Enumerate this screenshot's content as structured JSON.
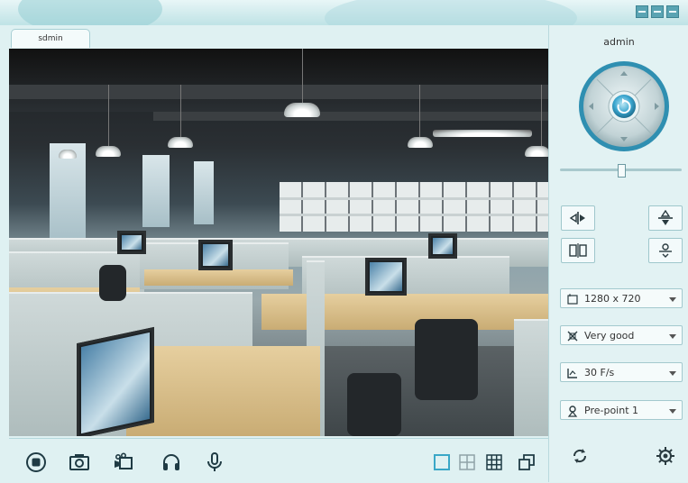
{
  "window": {
    "title_controls": [
      "minimize-icon",
      "maximize-icon",
      "close-icon"
    ]
  },
  "tabs": [
    {
      "label": "sdmin",
      "active": true
    }
  ],
  "toolbar": {
    "icons": [
      "stop-icon",
      "camera-icon",
      "video-record-icon",
      "headphones-icon",
      "microphone-icon"
    ],
    "layout_icons": [
      "single-view-icon",
      "quad-view-icon",
      "nine-view-icon",
      "popout-window-icon"
    ],
    "colors": {
      "icon": "#1f3b44",
      "active_layout": "#3aa7c7"
    }
  },
  "sidebar": {
    "user": "admin",
    "ptz": {
      "icons": [
        "arrow-up-icon",
        "arrow-down-icon",
        "arrow-left-icon",
        "arrow-right-icon",
        "ptz-center-icon"
      ]
    },
    "slider_value": 0.52,
    "buttons": [
      "flip-horizontal-icon",
      "flip-vertical-icon",
      "mirror-icon",
      "ir-cut-icon"
    ],
    "dropdowns": {
      "resolution": "1280 x 720",
      "quality": "Very good",
      "framerate": "30 F/s",
      "preset": "Pre-point 1"
    },
    "bottom_icons": [
      "refresh-icon",
      "settings-gear-icon"
    ]
  }
}
